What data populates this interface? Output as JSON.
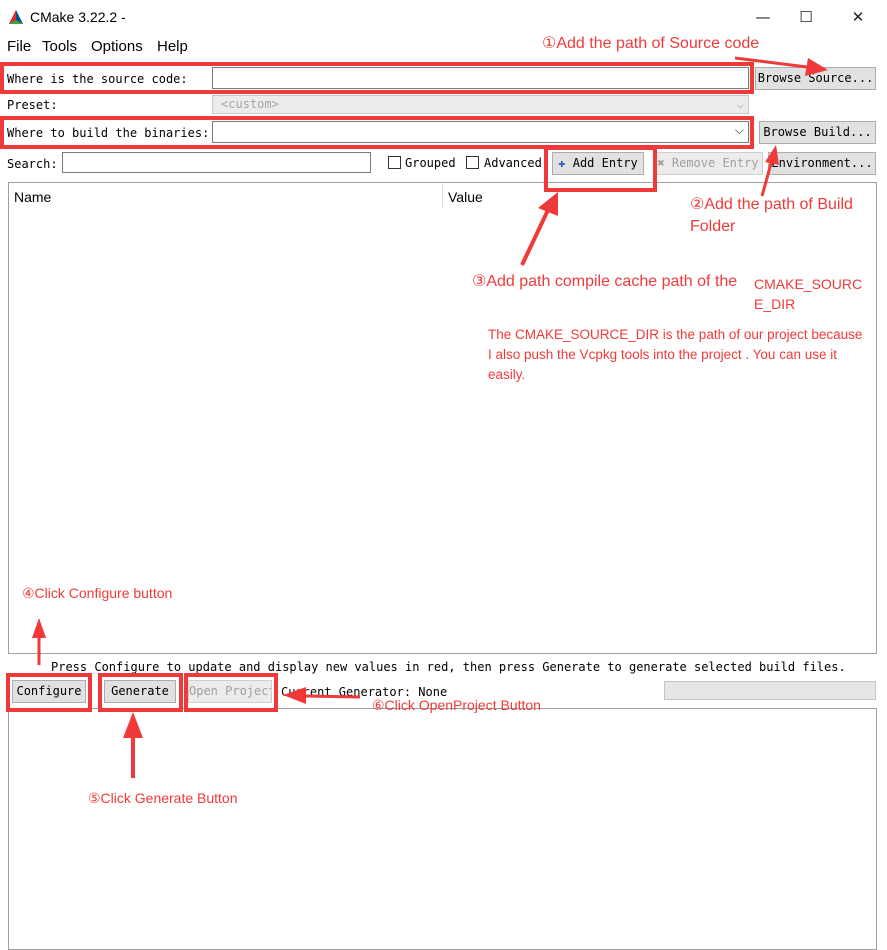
{
  "window": {
    "title": "CMake 3.22.2 -",
    "controls": {
      "minimize": "—",
      "maximize": "☐",
      "close": "✕"
    }
  },
  "menu": [
    "File",
    "Tools",
    "Options",
    "Help"
  ],
  "source": {
    "label": "Where is the source code:",
    "value": "",
    "browse_label": "Browse Source..."
  },
  "preset": {
    "label": "Preset:",
    "value": "<custom>"
  },
  "build": {
    "label": "Where to build the binaries:",
    "value": "",
    "browse_label": "Browse Build..."
  },
  "search": {
    "label": "Search:",
    "value": "",
    "grouped_label": "Grouped",
    "advanced_label": "Advanced",
    "add_entry_label": "Add Entry",
    "remove_entry_label": "Remove Entry",
    "environment_label": "Environment..."
  },
  "table": {
    "columns": [
      "Name",
      "Value"
    ]
  },
  "status_text": "Press Configure to update and display new values in red, then press Generate to generate selected build files.",
  "actions": {
    "configure_label": "Configure",
    "generate_label": "Generate",
    "open_project_label": "Open Project",
    "generator_text": "Current Generator: None"
  },
  "annotations": {
    "step1": "①Add the path of Source code",
    "step2": "②Add the path of Build Folder",
    "step3": "③Add path compile cache path of the",
    "step3_side": "CMAKE_SOURCE_DIR",
    "step3_note": "The CMAKE_SOURCE_DIR is the path of our project because I also push the Vcpkg tools into the project . You can use it easily.",
    "step4": "④Click Configure button",
    "step5": "⑤Click Generate Button",
    "step6": "⑥Click OpenProject Button",
    "color": "#f03a3a"
  }
}
